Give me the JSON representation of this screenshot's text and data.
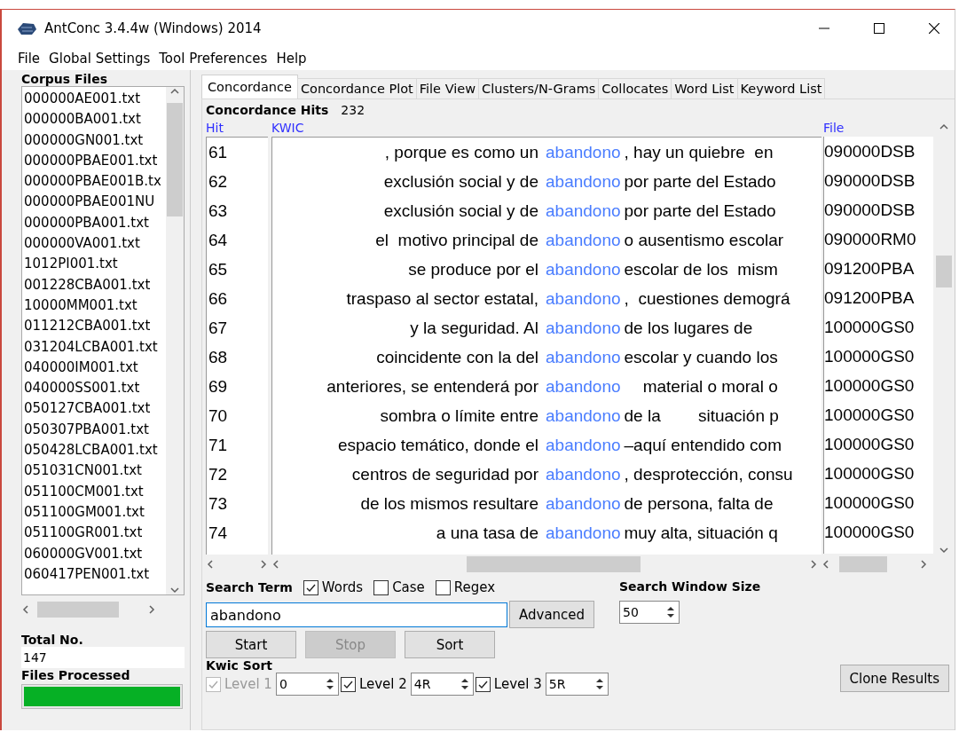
{
  "window": {
    "title": "AntConc 3.4.4w (Windows) 2014"
  },
  "menu": [
    "File",
    "Global Settings",
    "Tool Preferences",
    "Help"
  ],
  "corpus_files": {
    "label": "Corpus Files",
    "items": [
      "000000AE001.txt",
      "000000BA001.txt",
      "000000GN001.txt",
      "000000PBAE001.txt",
      "000000PBAE001B.tx",
      "000000PBAE001NU",
      "000000PBA001.txt",
      "000000VA001.txt",
      "1012PI001.txt",
      "001228CBA001.txt",
      "10000MM001.txt",
      "011212CBA001.txt",
      "031204LCBA001.txt",
      "040000IM001.txt",
      "040000SS001.txt",
      "050127CBA001.txt",
      "050307PBA001.txt",
      "050428LCBA001.txt",
      "051031CN001.txt",
      "051100CM001.txt",
      "051100GM001.txt",
      "051100GR001.txt",
      "060000GV001.txt",
      "060417PEN001.txt"
    ]
  },
  "total": {
    "label": "Total No.",
    "value": "147"
  },
  "files_processed": {
    "label": "Files Processed",
    "level": 1
  },
  "tabs": [
    {
      "label": "Concordance",
      "selected": true
    },
    {
      "label": "Concordance Plot",
      "selected": false
    },
    {
      "label": "File View",
      "selected": false
    },
    {
      "label": "Clusters/N-Grams",
      "selected": false
    },
    {
      "label": "Collocates",
      "selected": false
    },
    {
      "label": "Word List",
      "selected": false
    },
    {
      "label": "Keyword List",
      "selected": false
    }
  ],
  "concordance": {
    "hits_label": "Concordance Hits",
    "hits": "232",
    "columns": [
      "Hit",
      "KWIC",
      "File"
    ],
    "rows": [
      {
        "hit": "61",
        "left": ", porque es como un",
        "keyword": "abandono",
        "right": ", hay un quiebre  en",
        "file": "090000DSB"
      },
      {
        "hit": "62",
        "left": "exclusión social y de",
        "keyword": "abandono",
        "right": "por parte del Estado",
        "file": "090000DSB"
      },
      {
        "hit": "63",
        "left": "exclusión social y de",
        "keyword": "abandono",
        "right": "por parte del Estado",
        "file": "090000DSB"
      },
      {
        "hit": "64",
        "left": "el  motivo principal de",
        "keyword": "abandono",
        "right": "o ausentismo escolar",
        "file": "090000RM0"
      },
      {
        "hit": "65",
        "left": "se produce por el",
        "keyword": "abandono",
        "right": "escolar de los  mism",
        "file": "091200PBA"
      },
      {
        "hit": "66",
        "left": "traspaso al sector estatal,",
        "keyword": "abandono",
        "right": ",  cuestiones demográ",
        "file": "091200PBA"
      },
      {
        "hit": "67",
        "left": "y la seguridad. Al",
        "keyword": "abandono",
        "right": "de los lugares de",
        "file": "100000GS0"
      },
      {
        "hit": "68",
        "left": "coincidente con la del",
        "keyword": "abandono",
        "right": "escolar y cuando los",
        "file": "100000GS0"
      },
      {
        "hit": "69",
        "left": "anteriores, se entenderá por",
        "keyword": "abandono",
        "right": "    material o moral o",
        "file": "100000GS0"
      },
      {
        "hit": "70",
        "left": "sombra o límite entre",
        "keyword": "abandono",
        "right": "de la        situación p",
        "file": "100000GS0"
      },
      {
        "hit": "71",
        "left": "espacio temático, donde el",
        "keyword": "abandono",
        "right": "–aquí entendido com",
        "file": "100000GS0"
      },
      {
        "hit": "72",
        "left": "centros de seguridad por",
        "keyword": "abandono",
        "right": ", desprotección, consu",
        "file": "100000GS0"
      },
      {
        "hit": "73",
        "left": "de los mismos resultare",
        "keyword": "abandono",
        "right": "de persona, falta de",
        "file": "100000GS0"
      },
      {
        "hit": "74",
        "left": "a una tasa de",
        "keyword": "abandono",
        "right": "muy alta, situación q",
        "file": "100000GS0"
      }
    ]
  },
  "search": {
    "label": "Search Term",
    "options": [
      {
        "label": "Words",
        "checked": true
      },
      {
        "label": "Case",
        "checked": false
      },
      {
        "label": "Regex",
        "checked": false
      }
    ],
    "value": "abandono",
    "advanced": "Advanced",
    "buttons": [
      {
        "label": "Start",
        "disabled": false
      },
      {
        "label": "Stop",
        "disabled": true
      },
      {
        "label": "Sort",
        "disabled": false
      }
    ]
  },
  "window_size": {
    "label": "Search Window Size",
    "value": "50"
  },
  "kwic_sort": {
    "label": "Kwic Sort",
    "levels": [
      {
        "label": "Level 1",
        "checked": true,
        "disabled": true,
        "value": "0"
      },
      {
        "label": "Level 2",
        "checked": true,
        "disabled": false,
        "value": "4R"
      },
      {
        "label": "Level 3",
        "checked": true,
        "disabled": false,
        "value": "5R"
      }
    ]
  },
  "clone_button": "Clone Results"
}
